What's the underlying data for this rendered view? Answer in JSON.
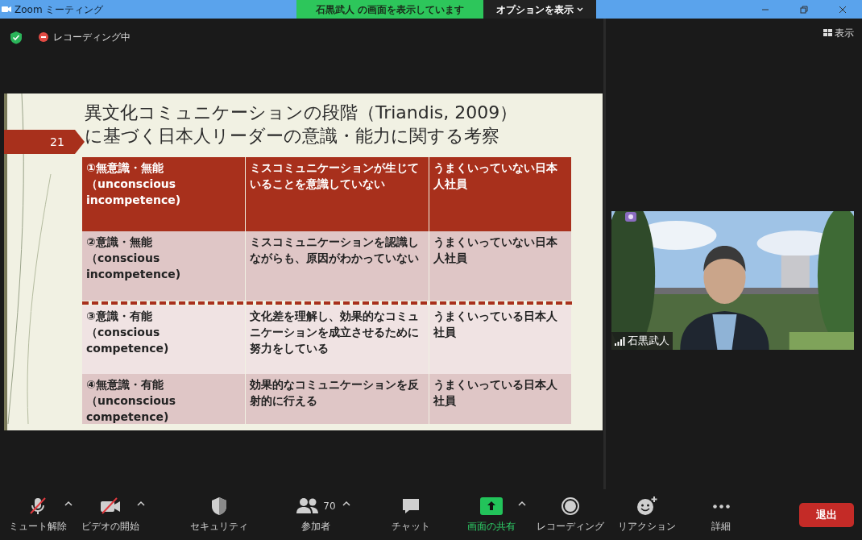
{
  "title_bar": {
    "title": "Zoom ミーティング",
    "banner": "石黒武人 の画面を表示しています",
    "options_button": "オプションを表示"
  },
  "top_bar": {
    "recording_label": "レコーディング中",
    "view_button": "表示"
  },
  "slide": {
    "number": "21",
    "title_lines": [
      "異文化コミュニケーションの段階（Triandis, 2009）",
      "に基づく日本人リーダーの意識・能力に関する考察"
    ],
    "rows": [
      {
        "kind": "highlight",
        "color": "#a8301c",
        "divider_before": false,
        "cells": [
          "①無意識・無能（unconscious incompetence)",
          "ミスコミュニケーションが生じていることを意識していない",
          "うまくいっていない日本人社員"
        ]
      },
      {
        "kind": "normal",
        "color": "#dfc6c6",
        "divider_before": false,
        "cells": [
          "②意識・無能（conscious incompetence)",
          "ミスコミュニケーションを認識しながらも、原因がわかっていない",
          "うまくいっていない日本人社員"
        ]
      },
      {
        "kind": "normal",
        "color": "#f0e3e3",
        "divider_before": true,
        "cells": [
          "③意識・有能（conscious competence)",
          "文化差を理解し、効果的なコミュニケーションを成立させるために努力をしている",
          "うまくいっている日本人社員"
        ]
      },
      {
        "kind": "normal",
        "color": "#dfc6c6",
        "divider_before": false,
        "cells": [
          "④無意識・有能（unconscious competence)",
          "効果的なコミュニケーションを反射的に行える",
          "うまくいっている日本人社員"
        ]
      }
    ]
  },
  "participant": {
    "name": "石黒武人"
  },
  "toolbar": [
    {
      "label": "ミュート解除",
      "kind": "mic",
      "off": true,
      "caret": true
    },
    {
      "label": "ビデオの開始",
      "kind": "video",
      "off": true,
      "caret": true
    },
    {
      "label": "セキュリティ",
      "kind": "shield",
      "caret": false
    },
    {
      "label": "参加者",
      "kind": "people",
      "count": "70",
      "caret": true
    },
    {
      "label": "チャット",
      "kind": "chat",
      "caret": false
    },
    {
      "label": "画面の共有",
      "kind": "share",
      "highlighted": true,
      "caret": true
    },
    {
      "label": "レコーディング",
      "kind": "record",
      "caret": false
    },
    {
      "label": "リアクション",
      "kind": "reaction",
      "caret": false
    },
    {
      "label": "詳細",
      "kind": "more",
      "caret": false
    }
  ],
  "leave_button": "退出"
}
